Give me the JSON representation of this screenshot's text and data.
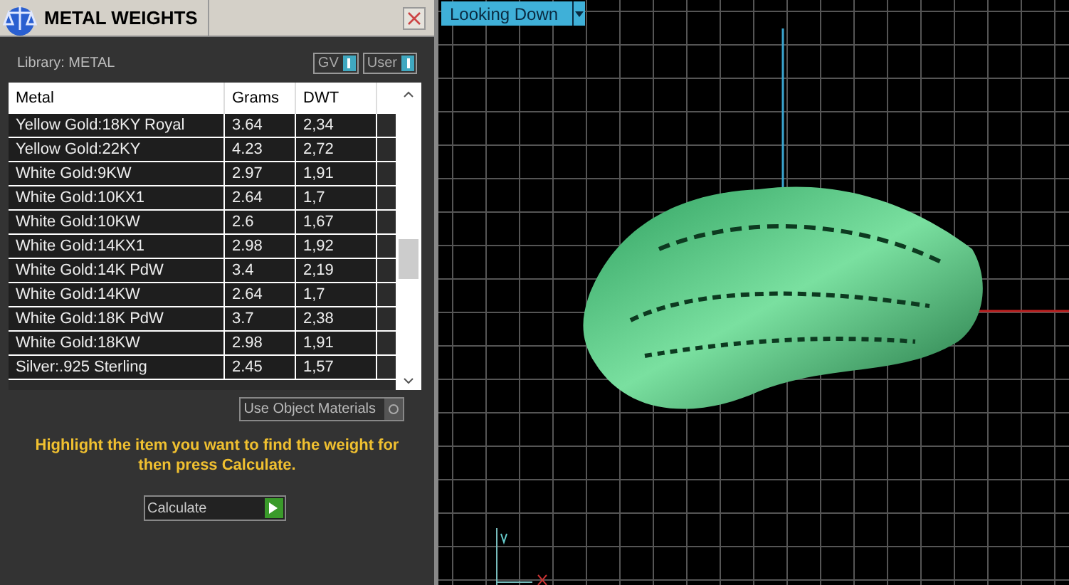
{
  "panel": {
    "title": "METAL WEIGHTS",
    "library_label": "Library: METAL",
    "toggles": [
      {
        "label": "GV",
        "on": true
      },
      {
        "label": "User",
        "on": true
      }
    ]
  },
  "table": {
    "columns": [
      "Metal",
      "Grams",
      "DWT"
    ],
    "rows": [
      {
        "metal": "Yellow Gold:18KY Royal",
        "grams": "3.64",
        "dwt": "2,34"
      },
      {
        "metal": "Yellow Gold:22KY",
        "grams": "4.23",
        "dwt": "2,72"
      },
      {
        "metal": "White Gold:9KW",
        "grams": "2.97",
        "dwt": "1,91"
      },
      {
        "metal": "White Gold:10KX1",
        "grams": "2.64",
        "dwt": "1,7"
      },
      {
        "metal": "White Gold:10KW",
        "grams": "2.6",
        "dwt": "1,67"
      },
      {
        "metal": "White Gold:14KX1",
        "grams": "2.98",
        "dwt": "1,92"
      },
      {
        "metal": "White Gold:14K PdW",
        "grams": "3.4",
        "dwt": "2,19"
      },
      {
        "metal": "White Gold:14KW",
        "grams": "2.64",
        "dwt": "1,7"
      },
      {
        "metal": "White Gold:18K PdW",
        "grams": "3.7",
        "dwt": "2,38"
      },
      {
        "metal": "White Gold:18KW",
        "grams": "2.98",
        "dwt": "1,91"
      },
      {
        "metal": "Silver:.925 Sterling",
        "grams": "2.45",
        "dwt": "1,57"
      }
    ]
  },
  "use_object_materials": {
    "label": "Use Object Materials",
    "checked": false
  },
  "hint": "Highlight the item you want to find the weight for then press Calculate.",
  "calculate_button": "Calculate",
  "viewport": {
    "view_dropdown": "Looking Down"
  }
}
